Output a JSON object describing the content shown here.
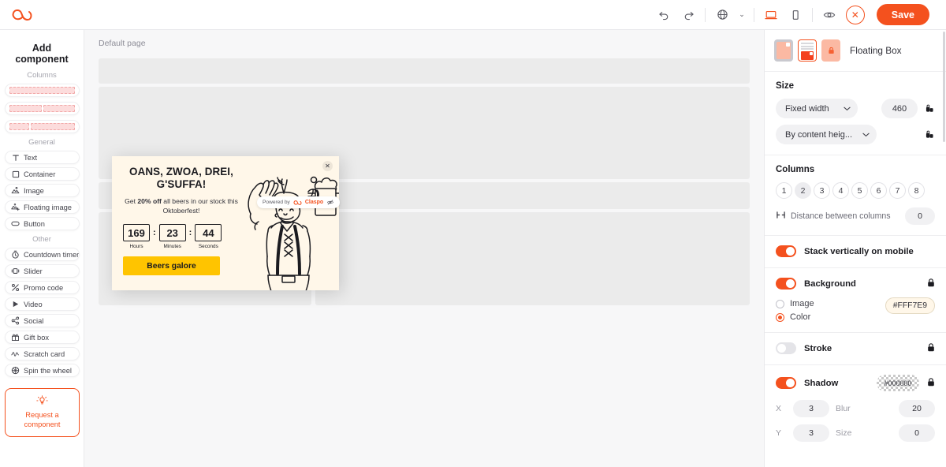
{
  "app": {
    "logo": "claspo-logo"
  },
  "toolbar": {
    "undo": "undo-icon",
    "redo": "redo-icon",
    "language": "globe-icon",
    "language_chevron": "⌄",
    "desktop": "desktop-icon",
    "mobile": "mobile-icon",
    "preview": "eye-icon",
    "close": "✕",
    "save_label": "Save"
  },
  "sidebar": {
    "title": "Add component",
    "groups": [
      {
        "label": "Columns",
        "templates": [
          {
            "name": "columns-1",
            "cells": [
              100
            ]
          },
          {
            "name": "columns-2-equal",
            "cells": [
              49,
              49
            ]
          },
          {
            "name": "columns-2-narrow-wide",
            "cells": [
              30,
              68
            ]
          }
        ]
      },
      {
        "label": "General",
        "items": [
          {
            "label": "Text",
            "icon": "text-icon"
          },
          {
            "label": "Container",
            "icon": "container-icon"
          },
          {
            "label": "Image",
            "icon": "image-icon"
          },
          {
            "label": "Floating image",
            "icon": "floating-image-icon"
          },
          {
            "label": "Button",
            "icon": "button-icon"
          }
        ]
      },
      {
        "label": "Other",
        "items": [
          {
            "label": "Countdown timer",
            "icon": "countdown-timer-icon"
          },
          {
            "label": "Slider",
            "icon": "slider-icon"
          },
          {
            "label": "Promo code",
            "icon": "promo-code-icon"
          },
          {
            "label": "Video",
            "icon": "video-icon"
          },
          {
            "label": "Social",
            "icon": "social-icon"
          },
          {
            "label": "Gift box",
            "icon": "gift-box-icon"
          },
          {
            "label": "Scratch card",
            "icon": "scratch-card-icon"
          },
          {
            "label": "Spin the wheel",
            "icon": "spin-the-wheel-icon"
          }
        ]
      }
    ],
    "request": {
      "line1": "Request a",
      "line2": "component",
      "icon": "lamp-idea-icon"
    }
  },
  "canvas": {
    "page_label": "Default page"
  },
  "popup": {
    "close_icon": "✕",
    "heading_line1": "OANS, ZWOA, DREI,",
    "heading_line2": "G'SUFFA!",
    "sub_pre": "Get ",
    "sub_bold": "20% off",
    "sub_post": " all beers in our stock this Oktoberfest!",
    "countdown": [
      {
        "value": "169",
        "label": "Hours"
      },
      {
        "value": "23",
        "label": "Minutes"
      },
      {
        "value": "44",
        "label": "Seconds"
      }
    ],
    "separator": ":",
    "cta_label": "Beers galore",
    "background_color": "#FFF7E9",
    "cta_color": "#FFC400",
    "illustration": "oktoberfest-man-with-beer-illustration"
  },
  "powered_by": {
    "prefix": "Powered by",
    "brand": "Claspo",
    "hide_icon": "eye-off-icon"
  },
  "properties": {
    "header": {
      "title": "Floating Box",
      "tabs": [
        {
          "name": "device-tab-overlay",
          "selected": false
        },
        {
          "name": "device-tab-floating-box",
          "selected": true
        },
        {
          "name": "device-tab-locked",
          "selected": false
        }
      ]
    },
    "size": {
      "title": "Size",
      "width_mode": "Fixed width",
      "width_value": "460",
      "height_mode": "By content heig...",
      "link_icon": "link-lock-icon"
    },
    "columns": {
      "title": "Columns",
      "options": [
        "1",
        "2",
        "3",
        "4",
        "5",
        "6",
        "7",
        "8"
      ],
      "selected": "2",
      "distance_label": "Distance between columns",
      "distance_value": "0",
      "distance_icon": "distance-columns-icon"
    },
    "stack": {
      "label": "Stack vertically on mobile",
      "enabled": true
    },
    "background": {
      "label": "Background",
      "enabled": true,
      "locked_icon": "lock-icon",
      "options": [
        {
          "label": "Image",
          "selected": false
        },
        {
          "label": "Color",
          "selected": true
        }
      ],
      "color_value": "#FFF7E9"
    },
    "stroke": {
      "label": "Stroke",
      "enabled": false,
      "locked_icon": "lock-icon"
    },
    "shadow": {
      "label": "Shadow",
      "enabled": true,
      "color_value": "#000000",
      "locked_icon": "lock-icon",
      "fields": [
        {
          "label": "X",
          "value": "3"
        },
        {
          "label": "Blur",
          "value": "20"
        },
        {
          "label": "Y",
          "value": "3"
        },
        {
          "label": "Size",
          "value": "0"
        }
      ]
    }
  }
}
